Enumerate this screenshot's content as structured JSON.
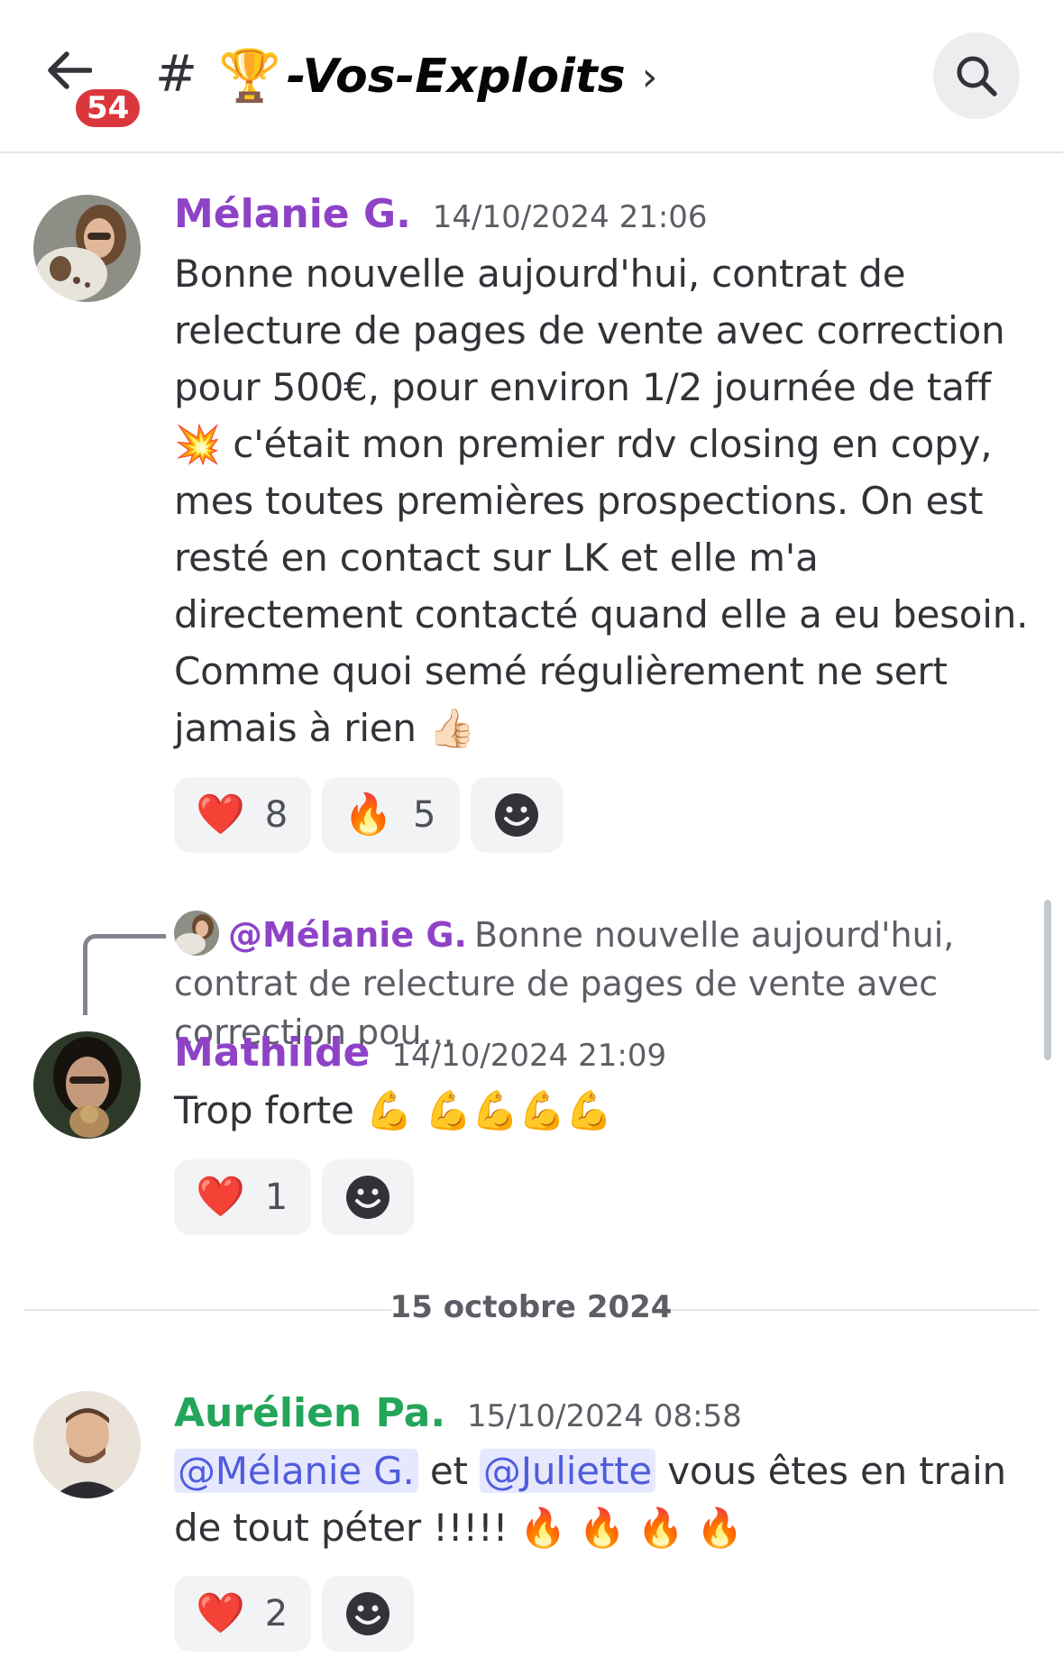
{
  "header": {
    "unread_badge": "54",
    "hash": "#",
    "trophy_emoji": "🏆",
    "channel_name": "-Vos-Exploits",
    "chevron": "›"
  },
  "messages": [
    {
      "author": "Mélanie G.",
      "author_color": "#8e43c7",
      "timestamp": "14/10/2024 21:06",
      "text": "Bonne nouvelle aujourd'hui, contrat de relecture de pages de vente avec correction pour 500€, pour environ 1/2 journée de taff 💥 c'était mon premier rdv closing en copy, mes toutes premières prospections. On est resté en contact sur LK et elle m'a directement contacté quand elle a eu besoin. Comme quoi semé régulièrement ne sert jamais à rien 👍🏻",
      "reactions": [
        {
          "emoji": "❤️",
          "count": "8"
        },
        {
          "emoji": "🔥",
          "count": "5"
        }
      ]
    },
    {
      "reply": {
        "author": "@Mélanie G.",
        "text": "Bonne nouvelle aujourd'hui, contrat de relecture de pages de vente avec correction pou..."
      },
      "author": "Mathilde",
      "author_color": "#8e43c7",
      "timestamp": "14/10/2024 21:09",
      "text": "Trop forte 💪 💪💪💪💪",
      "reactions": [
        {
          "emoji": "❤️",
          "count": "1"
        }
      ]
    },
    {
      "author": "Aurélien Pa.",
      "author_color": "#2dc770",
      "timestamp": "15/10/2024 08:58",
      "mention_1": "@Mélanie G.",
      "text_1": " et ",
      "mention_2": "@Juliette",
      "text_2": " vous êtes en train de tout péter !!!!! 🔥 🔥 🔥 🔥",
      "reactions": [
        {
          "emoji": "❤️",
          "count": "2"
        }
      ]
    }
  ],
  "date_divider": "15 octobre 2024",
  "icons": {
    "back": "arrow-left-icon",
    "search": "search-icon",
    "add_reaction": "smiley-icon"
  }
}
